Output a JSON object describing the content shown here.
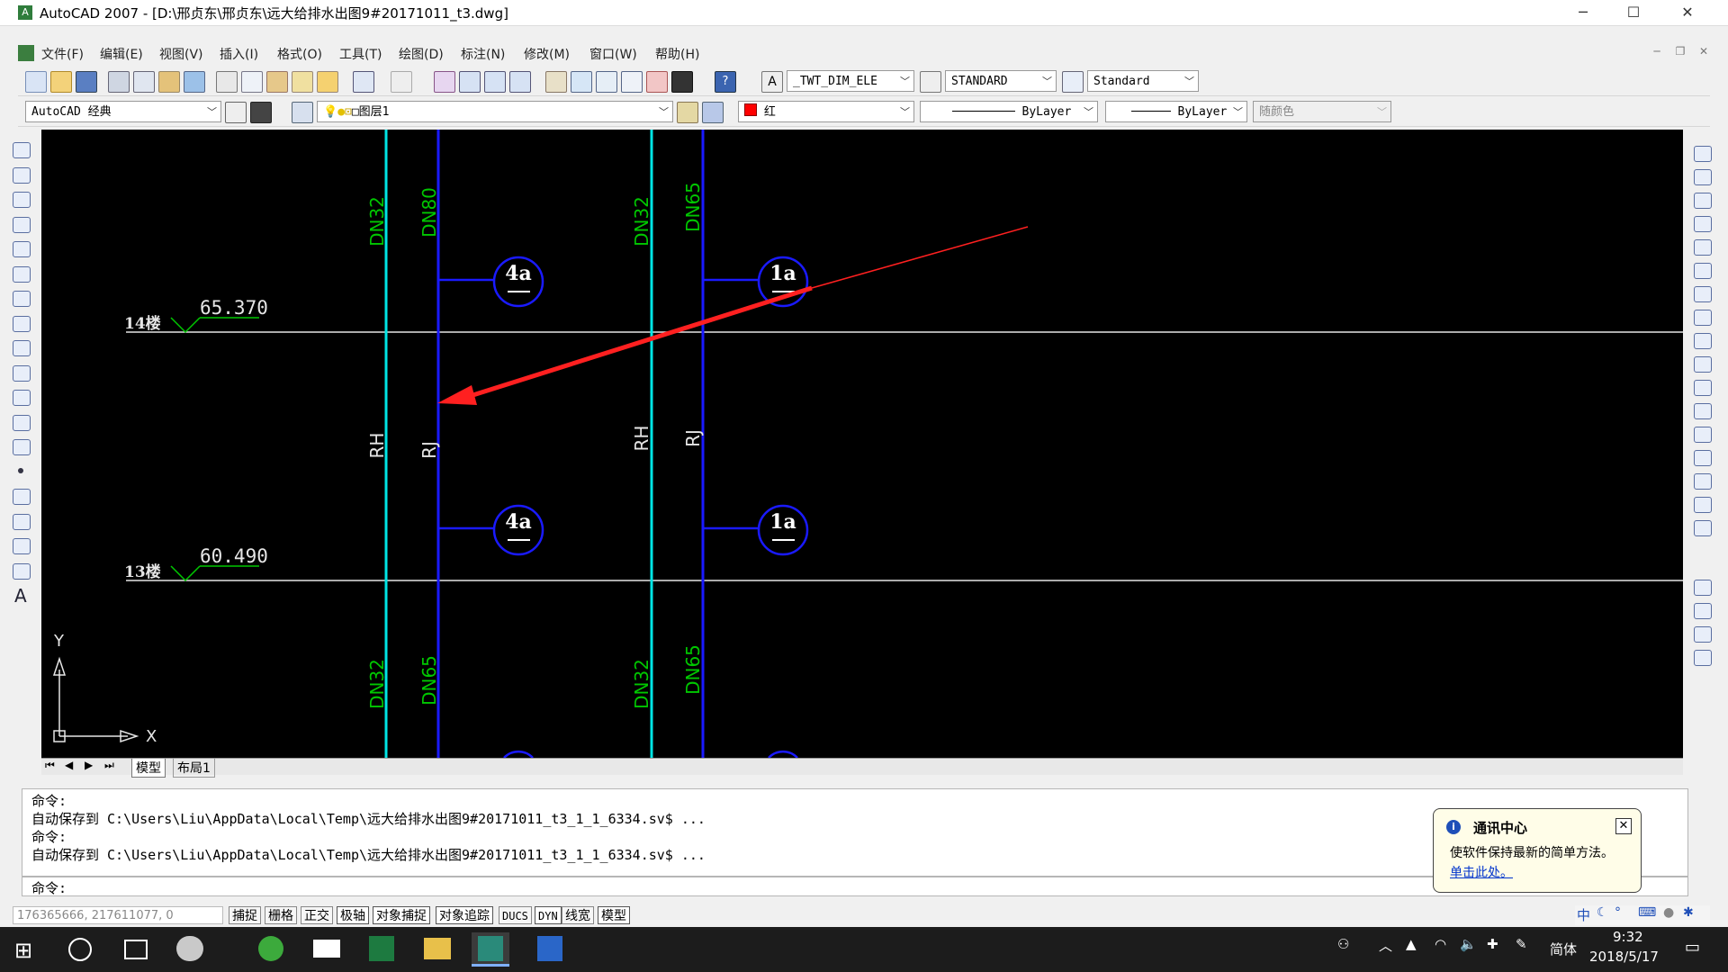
{
  "window": {
    "title": "AutoCAD 2007 - [D:\\邢贞东\\邢贞东\\远大给排水出图9#20171011_t3.dwg]",
    "minimize": "─",
    "maximize": "☐",
    "close": "✕"
  },
  "menu": [
    "文件(F)",
    "编辑(E)",
    "视图(V)",
    "插入(I)",
    "格式(O)",
    "工具(T)",
    "绘图(D)",
    "标注(N)",
    "修改(M)",
    "窗口(W)",
    "帮助(H)"
  ],
  "toolbar": {
    "text_style": "_TWT_DIM_ELE",
    "dim_style": "STANDARD",
    "table_style": "Standard",
    "workspace": "AutoCAD 经典",
    "layer": "图层1",
    "color": "红",
    "linetype": "ByLayer",
    "lineweight": "ByLayer",
    "plot_style": "随颜色"
  },
  "drawing": {
    "floors": [
      {
        "label": "14楼",
        "elevation": "65.370"
      },
      {
        "label": "13楼",
        "elevation": "60.490"
      }
    ],
    "pipe_labels_top": [
      "DN32",
      "DN80",
      "DN32",
      "DN65"
    ],
    "pipe_labels_bottom": [
      "DN32",
      "DN65",
      "DN32",
      "DN65"
    ],
    "pipe_names": [
      "RH",
      "RJ",
      "RH",
      "RJ"
    ],
    "meters": [
      "4a",
      "1a",
      "4a",
      "1a"
    ],
    "axis_x": "X",
    "axis_y": "Y",
    "colors": {
      "cyan": "#00e5e5",
      "blue": "#1a1aff",
      "green": "#00c800",
      "arrow": "#ff2020"
    }
  },
  "layout_tabs": [
    "模型",
    "布局1"
  ],
  "command": {
    "lines": [
      "命令:",
      "自动保存到 C:\\Users\\Liu\\AppData\\Local\\Temp\\远大给排水出图9#20171011_t3_1_1_6334.sv$ ...",
      "命令:",
      "自动保存到 C:\\Users\\Liu\\AppData\\Local\\Temp\\远大给排水出图9#20171011_t3_1_1_6334.sv$ ..."
    ],
    "prompt": "命令:"
  },
  "status": {
    "coords": "176365666, 217611077, 0",
    "buttons": [
      "捕捉",
      "栅格",
      "正交",
      "极轴",
      "对象捕捉",
      "对象追踪",
      "DUCS",
      "DYN",
      "线宽",
      "模型"
    ]
  },
  "balloon": {
    "title": "通讯中心",
    "body": "使软件保持最新的简单方法。",
    "link": "单击此处。"
  },
  "taskbar": {
    "ime": "简体",
    "time": "9:32",
    "date": "2018/5/17",
    "tray_ime_cn": "中"
  }
}
